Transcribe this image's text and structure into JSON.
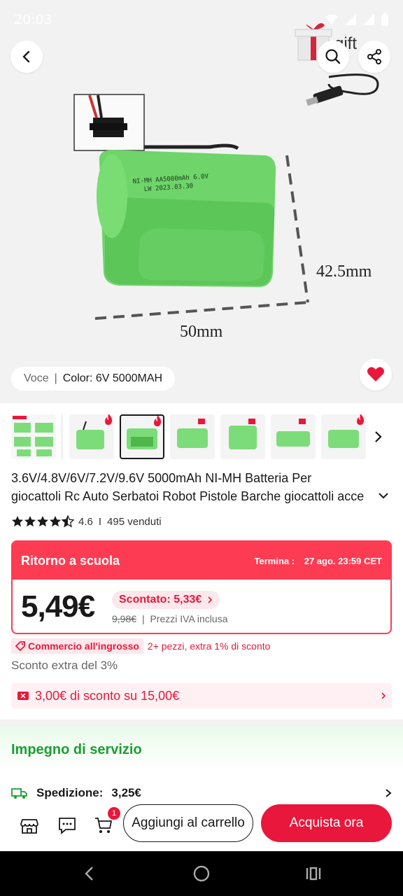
{
  "status_bar": {
    "time": "20:03"
  },
  "hero": {
    "gift_label": "gift",
    "dimension_height": "42.5mm",
    "dimension_width": "50mm",
    "battery_text_line1": "NI-MH AA5000mAh 6.0V",
    "battery_text_line2": "LW 2023.03.30"
  },
  "variant": {
    "label": "Voce",
    "separator": "|",
    "value": "Color: 6V 5000MAH"
  },
  "product": {
    "title_line1": "3.6V/4.8V/6V/7.2V/9.6V 5000mAh NI-MH Batteria Per",
    "title_line2": "giocattoli Rc Auto Serbatoi Robot Pistole Barche giocattoli acce",
    "rating": "4.6",
    "rating_separator": "I",
    "sold": "495 venduti",
    "stars": 4.5
  },
  "promo": {
    "name": "Ritorno a scuola",
    "ends_label": "Termina :",
    "ends_value": "27 ago. 23:59 CET",
    "price": "5,49€",
    "discount": "Scontato: 5,33€",
    "original_price": "9,98€",
    "vat_note": "Prezzi IVA inclusa"
  },
  "wholesale": {
    "badge": "Commercio all'ingrosso",
    "text": "2+ pezzi, extra 1% di sconto"
  },
  "extra_discount": "Sconto extra del 3%",
  "coupon": {
    "text": "3,00€ di sconto su 15,00€"
  },
  "service": {
    "title": "Impegno di servizio",
    "shipping_label": "Spedizione:",
    "shipping_value": "3,25€"
  },
  "bottom_bar": {
    "cart_count": "1",
    "add_to_cart": "Aggiungi al carrello",
    "buy_now": "Acquista ora"
  },
  "colors": {
    "accent": "#e8173b",
    "promo_red": "#fd3b52",
    "service_green": "#1a9f31",
    "battery_green": "#7ddc7a"
  }
}
